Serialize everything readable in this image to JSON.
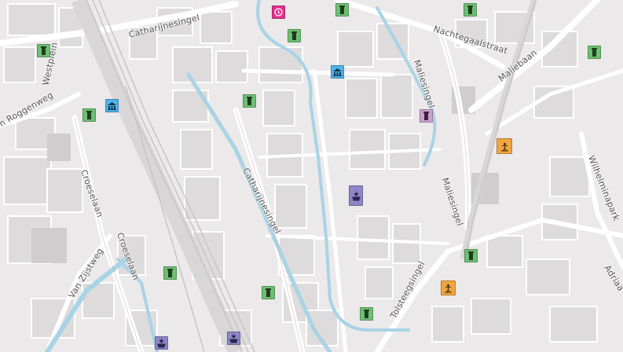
{
  "map": {
    "street_labels": {
      "catharijnesingel_top": "Catharijnesingel",
      "nachtegaalstraat": "Nachtegaalstraat",
      "maliebaan": "Maliebaan",
      "westplein": "Westplein",
      "maliesingel_top": "Maliesingel",
      "roggenweg": "n Roggenweg",
      "croeselaan_left": "Croeselaan",
      "croeselaan_mid": "Croeselaan",
      "catharijnesingel_mid": "Catharijnesingel",
      "maliesingel_right": "Maliesingel",
      "wilhelminapark": "Wilhelminapark",
      "van_zijstweg": "Van Zijstweg",
      "tolsteegsingel": "Tolsteegsingel",
      "adriaan": "Adriaa"
    },
    "poi_colors": {
      "green": "#6fbf73",
      "blue": "#4fb3e8",
      "magenta": "#e5308f",
      "purple": "#8c86c4",
      "orange": "#f0a640",
      "lilac": "#c9a3cf"
    },
    "poi_icons": {
      "museum": "museum-icon",
      "clock": "clock-icon",
      "fountain": "fountain-icon",
      "bank": "bank-icon",
      "attraction": "attraction-icon"
    },
    "water_color": "#a9d3e6",
    "rail_color": "#c8c8c8"
  }
}
